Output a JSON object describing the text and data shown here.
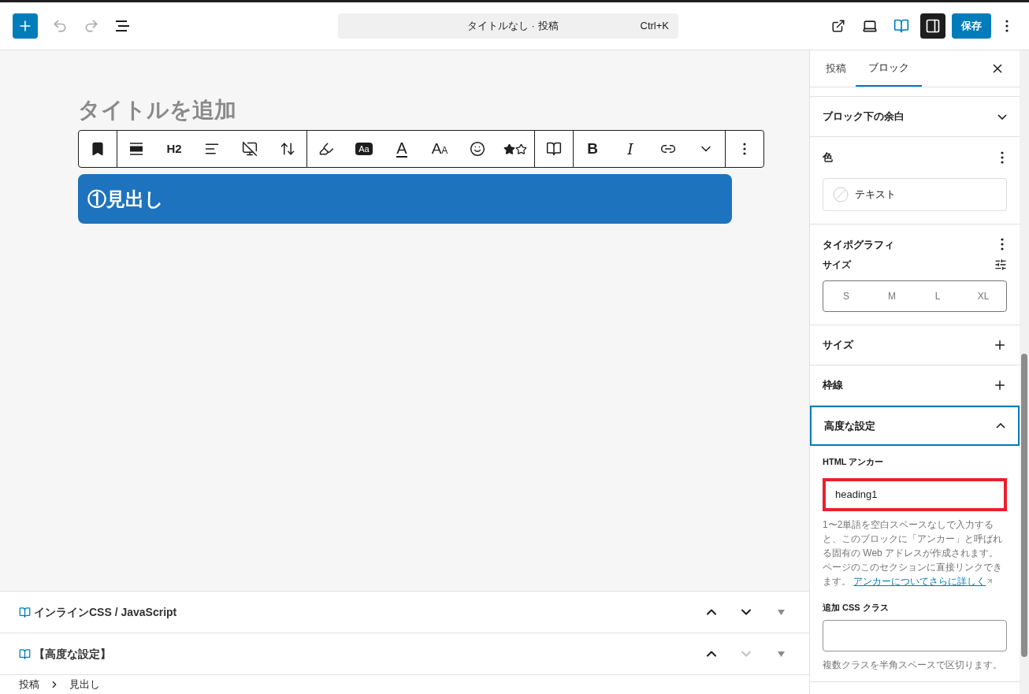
{
  "topbar": {
    "command_title": "タイトルなし · 投稿",
    "shortcut": "Ctrl+K",
    "save": "保存",
    "sidebar_toggle_on": true
  },
  "editor": {
    "title_placeholder": "タイトルを追加",
    "heading": "①見出し",
    "toolbar": [
      [
        {
          "kind": "icon"
        }
      ],
      [
        {
          "kind": "icon"
        },
        {
          "kind": "text",
          "label": "H2"
        },
        {
          "kind": "icon"
        },
        {
          "kind": "icon"
        },
        {
          "kind": "icon"
        }
      ],
      [
        {
          "kind": "icon"
        },
        {
          "kind": "badge",
          "label": "Aa"
        },
        {
          "kind": "underline",
          "label": "A"
        },
        {
          "kind": "size",
          "label": "A",
          "small": "A"
        },
        {
          "kind": "icon"
        },
        {
          "kind": "icon"
        }
      ],
      [
        {
          "kind": "icon"
        }
      ],
      [
        {
          "kind": "bold",
          "label": "B"
        },
        {
          "kind": "italic",
          "label": "I"
        },
        {
          "kind": "icon"
        },
        {
          "kind": "icon"
        }
      ],
      [
        {
          "kind": "icon"
        }
      ]
    ]
  },
  "meta_boxes": [
    {
      "title": "インラインCSS / JavaScript",
      "down_disabled": false
    },
    {
      "title": "【高度な設定】",
      "down_disabled": true
    }
  ],
  "breadcrumb": [
    "投稿",
    "見出し"
  ],
  "sidebar": {
    "tabs": [
      {
        "label": "投稿",
        "selected": false
      },
      {
        "label": "ブロック",
        "selected": true
      }
    ],
    "spacing_panel": {
      "title": "ブロック下の余白",
      "expanded": false
    },
    "color_panel": {
      "title": "色",
      "items": [
        "テキスト"
      ]
    },
    "typography_panel": {
      "title": "タイポグラフィ",
      "size_label": "サイズ",
      "sizes": [
        {
          "label": "S",
          "selected": false
        },
        {
          "label": "M",
          "selected": false
        },
        {
          "label": "L",
          "selected": false
        },
        {
          "label": "XL",
          "selected": false
        }
      ]
    },
    "collapsed_panels": [
      "サイズ",
      "枠線"
    ],
    "advanced_panel": {
      "title": "高度な設定",
      "expanded": true,
      "anchor_label": "HTML アンカー",
      "anchor_value": "heading1",
      "anchor_highlighted": true,
      "anchor_help": "1〜2単語を空白スペースなしで入力すると、このブロックに「アンカー」と呼ばれる固有の Web アドレスが作成されます。ページのこのセクションに直接リンクできます。",
      "anchor_link": "アンカーについてさらに詳しく",
      "css_label": "追加 CSS クラス",
      "css_help": "複数クラスを半角スペースで区切ります。"
    }
  }
}
